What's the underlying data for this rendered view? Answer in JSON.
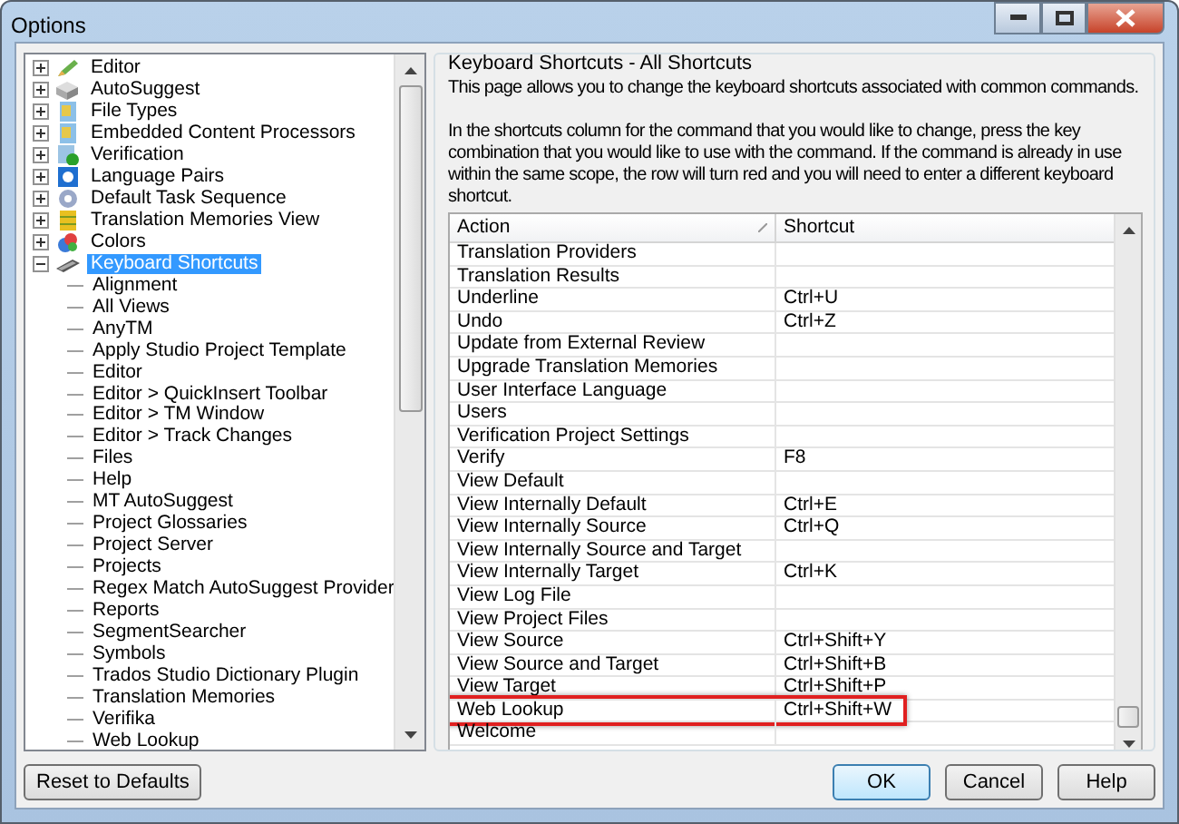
{
  "window": {
    "title": "Options"
  },
  "tree": {
    "items": [
      {
        "label": "Editor",
        "expanded": false,
        "selected": false
      },
      {
        "label": "AutoSuggest",
        "expanded": false,
        "selected": false
      },
      {
        "label": "File Types",
        "expanded": false,
        "selected": false
      },
      {
        "label": "Embedded Content Processors",
        "expanded": false,
        "selected": false
      },
      {
        "label": "Verification",
        "expanded": false,
        "selected": false
      },
      {
        "label": "Language Pairs",
        "expanded": false,
        "selected": false
      },
      {
        "label": "Default Task Sequence",
        "expanded": false,
        "selected": false
      },
      {
        "label": "Translation Memories View",
        "expanded": false,
        "selected": false
      },
      {
        "label": "Colors",
        "expanded": false,
        "selected": false
      },
      {
        "label": "Keyboard Shortcuts",
        "expanded": true,
        "selected": true,
        "children": [
          {
            "label": "Alignment",
            "selected": false
          },
          {
            "label": "All Views",
            "selected": false
          },
          {
            "label": "AnyTM",
            "selected": false
          },
          {
            "label": "Apply Studio Project Template",
            "selected": false
          },
          {
            "label": "Editor",
            "selected": false
          },
          {
            "label": "Editor > QuickInsert Toolbar",
            "selected": false
          },
          {
            "label": "Editor > TM Window",
            "selected": false
          },
          {
            "label": "Editor > Track Changes",
            "selected": false
          },
          {
            "label": "Files",
            "selected": false
          },
          {
            "label": "Help",
            "selected": false
          },
          {
            "label": "MT AutoSuggest",
            "selected": false
          },
          {
            "label": "Project Glossaries",
            "selected": false
          },
          {
            "label": "Project Server",
            "selected": false
          },
          {
            "label": "Projects",
            "selected": false
          },
          {
            "label": "Regex Match AutoSuggest Provider",
            "selected": false
          },
          {
            "label": "Reports",
            "selected": false
          },
          {
            "label": "SegmentSearcher",
            "selected": false
          },
          {
            "label": "Symbols",
            "selected": false
          },
          {
            "label": "Trados Studio Dictionary Plugin",
            "selected": false
          },
          {
            "label": "Translation Memories",
            "selected": false
          },
          {
            "label": "Verifika",
            "selected": false
          },
          {
            "label": "Web Lookup",
            "selected": false
          }
        ]
      }
    ]
  },
  "panel": {
    "title": "Keyboard Shortcuts - All Shortcuts",
    "intro": "This page allows you to change the keyboard shortcuts associated with common commands.",
    "instructions": "In the shortcuts column for the command that you would like to change, press the key combination that you would like to use with the command.  If the command is already in use within the same scope, the row will turn red and you will need to enter a different keyboard shortcut."
  },
  "table": {
    "columns": [
      "Action",
      "Shortcut"
    ],
    "rows": [
      {
        "action": "Translation Providers",
        "shortcut": "",
        "highlighted": false
      },
      {
        "action": "Translation Results",
        "shortcut": "",
        "highlighted": false
      },
      {
        "action": "Underline",
        "shortcut": "Ctrl+U",
        "highlighted": false
      },
      {
        "action": "Undo",
        "shortcut": "Ctrl+Z",
        "highlighted": false
      },
      {
        "action": "Update from External Review",
        "shortcut": "",
        "highlighted": false
      },
      {
        "action": "Upgrade Translation Memories",
        "shortcut": "",
        "highlighted": false
      },
      {
        "action": "User Interface Language",
        "shortcut": "",
        "highlighted": false
      },
      {
        "action": "Users",
        "shortcut": "",
        "highlighted": false
      },
      {
        "action": "Verification Project Settings",
        "shortcut": "",
        "highlighted": false
      },
      {
        "action": "Verify",
        "shortcut": "F8",
        "highlighted": false
      },
      {
        "action": "View Default",
        "shortcut": "",
        "highlighted": false
      },
      {
        "action": "View Internally Default",
        "shortcut": "Ctrl+E",
        "highlighted": false
      },
      {
        "action": "View Internally Source",
        "shortcut": "Ctrl+Q",
        "highlighted": false
      },
      {
        "action": "View Internally Source and Target",
        "shortcut": "",
        "highlighted": false
      },
      {
        "action": "View Internally Target",
        "shortcut": "Ctrl+K",
        "highlighted": false
      },
      {
        "action": "View Log File",
        "shortcut": "",
        "highlighted": false
      },
      {
        "action": "View Project Files",
        "shortcut": "",
        "highlighted": false
      },
      {
        "action": "View Source",
        "shortcut": "Ctrl+Shift+Y",
        "highlighted": false
      },
      {
        "action": "View Source and Target",
        "shortcut": "Ctrl+Shift+B",
        "highlighted": false
      },
      {
        "action": "View Target",
        "shortcut": "Ctrl+Shift+P",
        "highlighted": false
      },
      {
        "action": "Web Lookup",
        "shortcut": "Ctrl+Shift+W",
        "highlighted": true
      },
      {
        "action": "Welcome",
        "shortcut": "",
        "highlighted": false
      }
    ]
  },
  "buttons": {
    "left": [
      "Reset to Defaults"
    ],
    "right": [
      "OK",
      "Cancel",
      "Help"
    ]
  }
}
